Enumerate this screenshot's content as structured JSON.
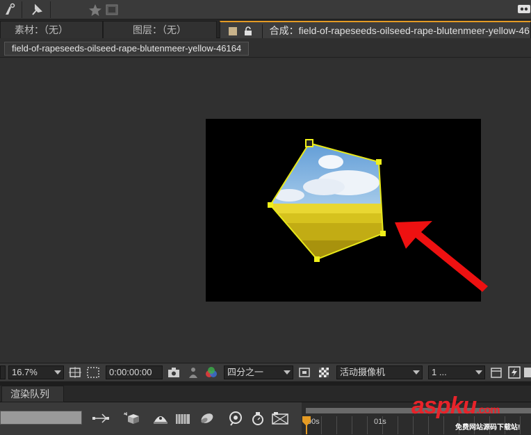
{
  "tabs": {
    "footage": "素材：（无）",
    "layer": "图层：（无）",
    "composition_prefix": "合成：",
    "composition_name": "field-of-rapeseeds-oilseed-rape-blutenmeer-yellow-46164"
  },
  "breadcrumb": "field-of-rapeseeds-oilseed-rape-blutenmeer-yellow-46164",
  "controls": {
    "zoom": "16.7%",
    "timecode": "0:00:00:00",
    "resolution": "四分之一",
    "camera": "活动摄像机",
    "views": "1 ..."
  },
  "render_queue_tab": "渲染队列",
  "timeline": {
    "label_0": "00s",
    "label_1": "01s"
  },
  "watermark": {
    "brand": "aspku",
    "suffix": ".com",
    "subtitle": "免费网站源码下载站!"
  },
  "colors": {
    "mask_outline": "#e8e81a",
    "arrow": "#ee1111",
    "accent_tab": "#e59b24",
    "watermark": "#e8232a"
  }
}
